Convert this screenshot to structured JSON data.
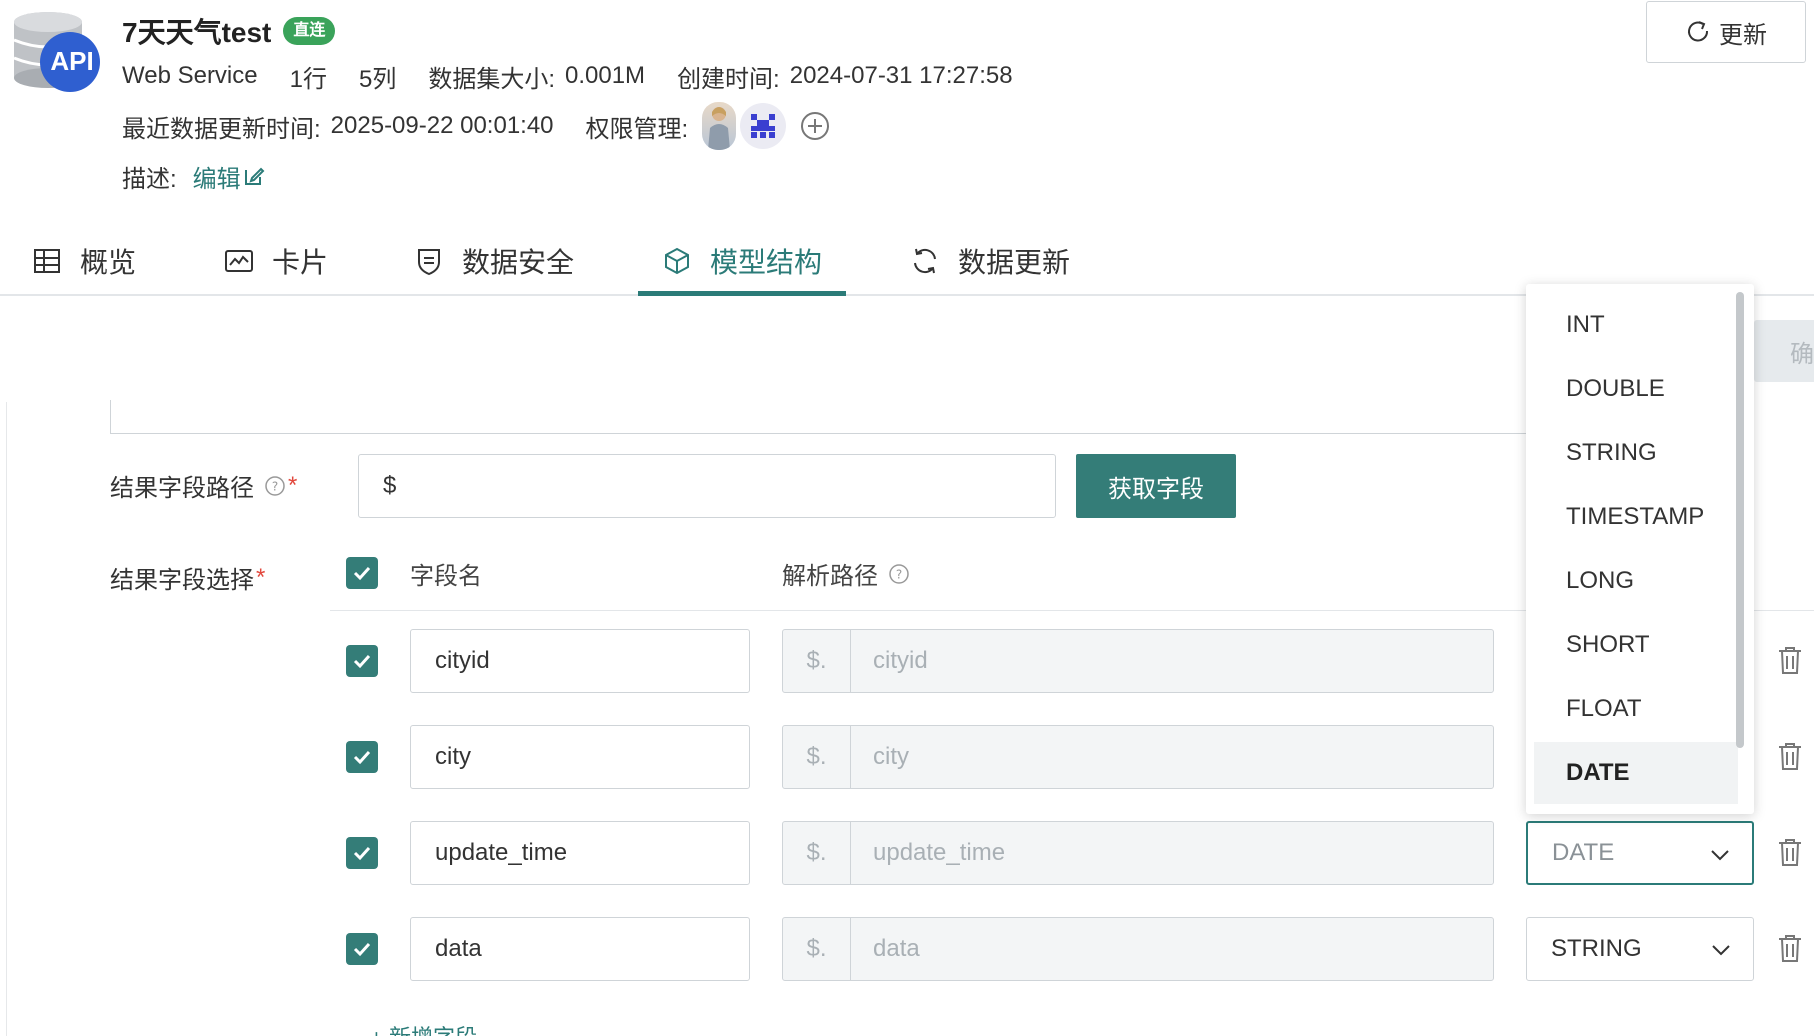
{
  "header": {
    "logo_text": "API",
    "title": "7天天气test",
    "badge": "直连",
    "type": "Web Service",
    "rows": "1行",
    "cols": "5列",
    "size_label": "数据集大小:",
    "size_value": "0.001M",
    "created_label": "创建时间:",
    "created_value": "2024-07-31 17:27:58",
    "updated_label": "最近数据更新时间:",
    "updated_value": "2025-09-22 00:01:40",
    "perm_label": "权限管理:",
    "desc_label": "描述:",
    "edit_label": "编辑",
    "refresh_label": "更新"
  },
  "tabs": [
    {
      "label": "概览",
      "icon": "table-icon"
    },
    {
      "label": "卡片",
      "icon": "chart-card-icon"
    },
    {
      "label": "数据安全",
      "icon": "shield-icon"
    },
    {
      "label": "模型结构",
      "icon": "cube-icon",
      "active": true
    },
    {
      "label": "数据更新",
      "icon": "refresh-icon"
    }
  ],
  "form": {
    "confirm_label": "确",
    "result_path_label": "结果字段路径",
    "result_path_value": "$",
    "fetch_label": "获取字段",
    "field_select_label": "结果字段选择",
    "required_mark": "*",
    "col_name": "字段名",
    "col_path": "解析路径",
    "add_field_label": "+ 新增字段"
  },
  "fields": [
    {
      "name": "cityid",
      "prefix": "$.",
      "path": "cityid",
      "type": ""
    },
    {
      "name": "city",
      "prefix": "$.",
      "path": "city",
      "type": ""
    },
    {
      "name": "update_time",
      "prefix": "$.",
      "path": "update_time",
      "type": "DATE"
    },
    {
      "name": "data",
      "prefix": "$.",
      "path": "data",
      "type": "STRING"
    }
  ],
  "dropdown": {
    "options": [
      "INT",
      "DOUBLE",
      "STRING",
      "TIMESTAMP",
      "LONG",
      "SHORT",
      "FLOAT",
      "DATE"
    ],
    "selected": "DATE"
  },
  "colors": {
    "accent": "#2b7b78",
    "button": "#347d78",
    "badge": "#3aa35a",
    "required": "#e2483d",
    "logo_blue": "#2f5fd0"
  }
}
